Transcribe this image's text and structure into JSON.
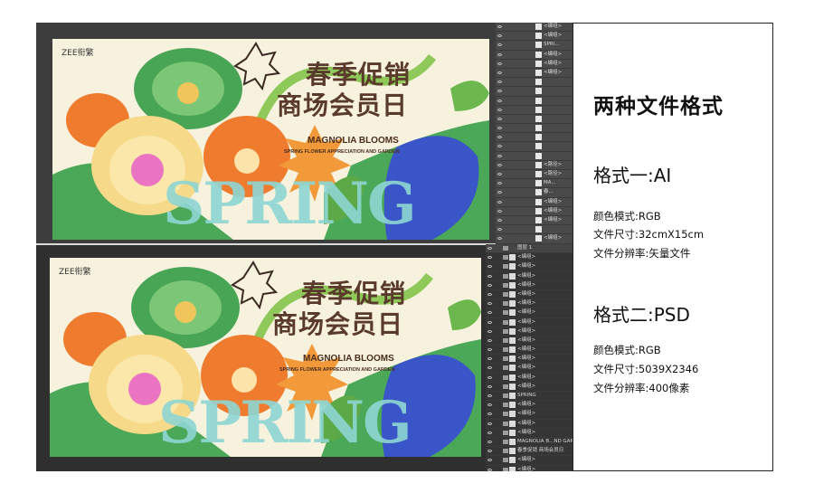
{
  "info": {
    "title": "两种文件格式",
    "format_ai": {
      "heading": "格式一:AI",
      "color_mode": "颜色模式:RGB",
      "size": "文件尺寸:32cmX15cm",
      "resolution": "文件分辨率:矢量文件"
    },
    "format_psd": {
      "heading": "格式二:PSD",
      "color_mode": "颜色模式:RGB",
      "size": "文件尺寸:5039X2346",
      "resolution": "文件分辨率:400像素"
    }
  },
  "artwork": {
    "brand": "ZEE衔繁",
    "title_line1": "春季促销",
    "title_line2": "商场会员日",
    "subtitle": "MAGNOLIA BLOOMS",
    "tagline": "SPRING FLOWER APPRECIATION AND GARDEN",
    "big_word": "SPRING"
  },
  "colors": {
    "background": "#f7f2de",
    "green": "#3f9a4a",
    "orange": "#ef7b2e",
    "yellow": "#f7d98a",
    "blue": "#3a55c8",
    "teal": "#8ed6d3"
  },
  "ai_layers": [
    "<编组>",
    "<编组>",
    "SPRI...",
    "<编组>",
    "<编组>",
    "<编组>",
    "",
    "",
    "",
    "",
    "",
    "",
    "",
    "",
    "",
    "<路径>",
    "<路径>",
    "MA...",
    "春...",
    "<编组>",
    "<编组>",
    "<编组>",
    "",
    "<编组>",
    "<编组>"
  ],
  "psd_layers": {
    "root": "图层 1",
    "items": [
      "<编组>",
      "<编组>",
      "<编组>",
      "<编组>",
      "<编组>",
      "<编组>",
      "<编组>",
      "<编组>",
      "<编组>",
      "<编组>",
      "<编组>",
      "<编组>",
      "<编组>",
      "<编组>",
      "<编组>",
      "SPRING",
      "<编组>",
      "<编组>",
      "<编组>",
      "<编组>",
      "MAGNOLIA B...ND GARDEN",
      "春季促销 商场会员日",
      "<编组>",
      "<编组>"
    ]
  }
}
